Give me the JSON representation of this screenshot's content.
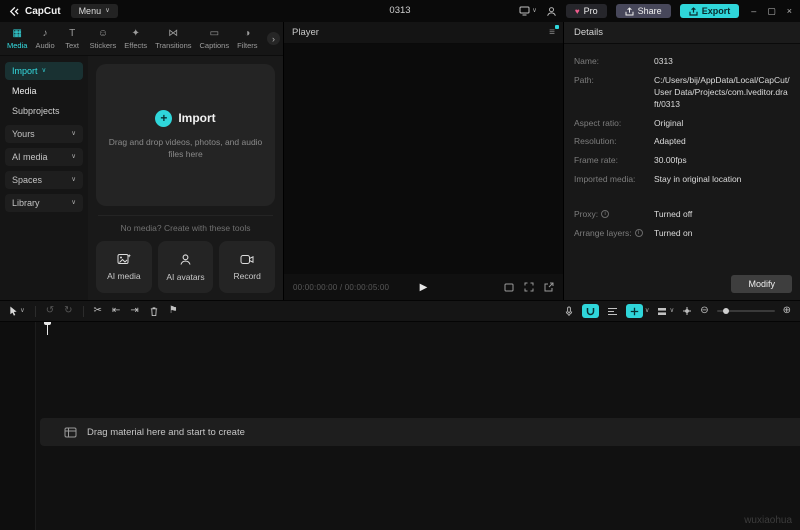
{
  "colors": {
    "accent": "#2fd6da"
  },
  "glyphs": {
    "chevron_down": "∨",
    "chevron_right": "›",
    "plus": "+",
    "play": "▶",
    "menu": "≡",
    "undo": "↺",
    "redo": "↻",
    "split": "✂",
    "trim_left": "⇤",
    "trim_right": "⇥",
    "mark": "⚑",
    "heart": "♥",
    "minimize": "–",
    "maximize": "▢",
    "close": "×",
    "zoom_in": "⊕",
    "zoom_out": "⊖"
  },
  "titlebar": {
    "app_name": "CapCut",
    "menu_label": "Menu",
    "project_title": "0313",
    "pro_label": "Pro",
    "share_label": "Share",
    "export_label": "Export"
  },
  "tabs": [
    {
      "label": "Media",
      "icon": "▦"
    },
    {
      "label": "Audio",
      "icon": "♪"
    },
    {
      "label": "Text",
      "icon": "T"
    },
    {
      "label": "Stickers",
      "icon": "☺"
    },
    {
      "label": "Effects",
      "icon": "✦"
    },
    {
      "label": "Transitions",
      "icon": "⋈"
    },
    {
      "label": "Captions",
      "icon": "▭"
    },
    {
      "label": "Filters",
      "icon": "◑"
    }
  ],
  "sidebar": {
    "items": [
      {
        "label": "Import"
      },
      {
        "label": "Media"
      },
      {
        "label": "Subprojects"
      },
      {
        "label": "Yours"
      },
      {
        "label": "AI media"
      },
      {
        "label": "Spaces"
      },
      {
        "label": "Library"
      }
    ]
  },
  "media_panel": {
    "import_label": "Import",
    "dropzone_hint": "Drag and drop videos, photos, and audio files here",
    "tools_hint": "No media? Create with these tools",
    "tools": [
      {
        "label": "AI media"
      },
      {
        "label": "AI avatars"
      },
      {
        "label": "Record"
      }
    ]
  },
  "player": {
    "title": "Player",
    "timecode": "00:00:00:00 / 00:00:05:00"
  },
  "details": {
    "title": "Details",
    "rows": [
      {
        "label": "Name:",
        "value": "0313"
      },
      {
        "label": "Path:",
        "value": "C:/Users/bij/AppData/Local/CapCut/User Data/Projects/com.lveditor.draft/0313"
      },
      {
        "label": "Aspect ratio:",
        "value": "Original"
      },
      {
        "label": "Resolution:",
        "value": "Adapted"
      },
      {
        "label": "Frame rate:",
        "value": "30.00fps"
      },
      {
        "label": "Imported media:",
        "value": "Stay in original location"
      },
      {
        "label": "Proxy:",
        "value": "Turned off"
      },
      {
        "label": "Arrange layers:",
        "value": "Turned on"
      }
    ],
    "modify_label": "Modify"
  },
  "timeline": {
    "placeholder": "Drag material here and start to create",
    "watermark": "wuxiaohua"
  }
}
